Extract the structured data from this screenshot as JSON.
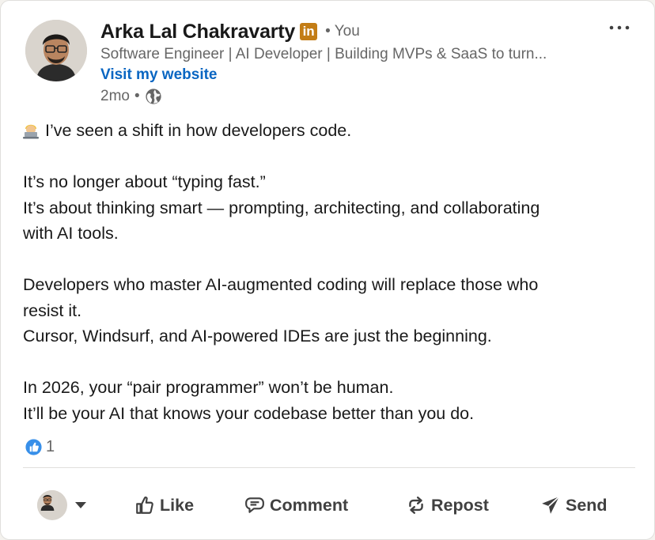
{
  "author": {
    "name": "Arka Lal Chakravarty",
    "badge": "in",
    "relation": "• You",
    "headline": "Software Engineer | AI Developer | Building MVPs & SaaS to turn...",
    "website_link": "Visit my website",
    "timestamp": "2mo",
    "visibility_sep": "•",
    "visibility_icon": "globe-icon"
  },
  "post": {
    "lines": [
      "I’ve seen a shift in how developers code.",
      "It’s no longer about “typing fast.”",
      "It’s about thinking smart — prompting, architecting, and collaborating",
      "with AI tools.",
      "Developers who master AI-augmented coding will replace those who",
      "resist it.",
      "Cursor, Windsurf, and AI-powered IDEs are just the beginning.",
      "In 2026, your “pair programmer” won’t be human.",
      "It’ll be your AI that knows your codebase better than you do."
    ]
  },
  "reactions": {
    "icon": "like-reaction-icon",
    "count": "1"
  },
  "actions": {
    "like": "Like",
    "comment": "Comment",
    "repost": "Repost",
    "send": "Send"
  },
  "colors": {
    "link": "#0a66c2",
    "badge": "#c37d16",
    "secondary_text": "#666666",
    "action_text": "#404040"
  }
}
